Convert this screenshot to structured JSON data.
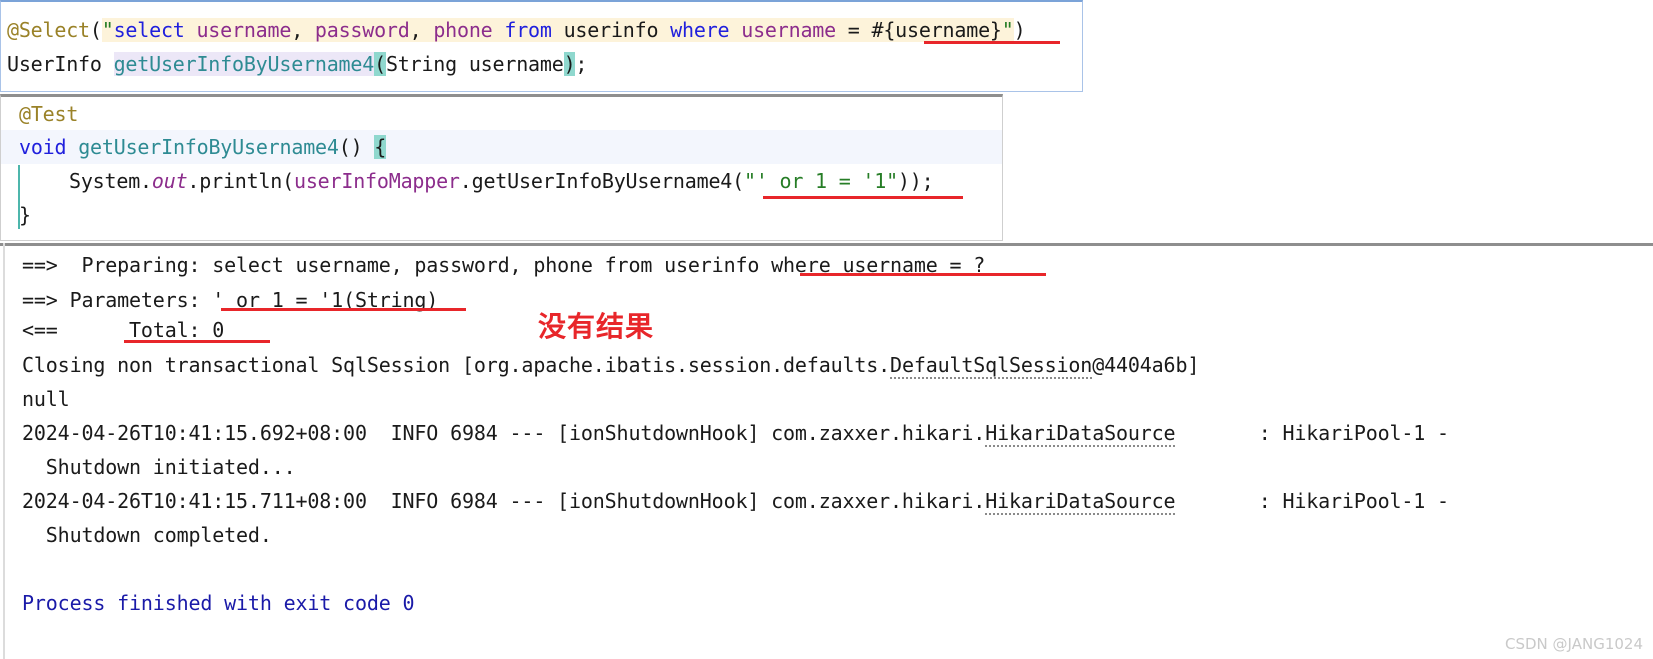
{
  "mapper_panel": {
    "name": "mapper-interface-snippet",
    "line1": {
      "annotation": "@Select",
      "paren_open": "(",
      "quote_open": "\"",
      "sql_select": "select",
      "sql_sp1": " ",
      "sql_username": "username",
      "sql_comma1": ", ",
      "sql_password": "password",
      "sql_comma2": ", ",
      "sql_phone": "phone",
      "sql_sp2": " ",
      "sql_from": "from",
      "sql_sp3": " ",
      "sql_table": "userinfo",
      "sql_sp4": " ",
      "sql_where": "where",
      "sql_sp5": " ",
      "sql_col": "username",
      "sql_eq": " = ",
      "sql_param": "#{username}",
      "quote_close": "\"",
      "paren_close": ")",
      "full_text": "@Select(\"select username, password, phone from userinfo where username = #{username}\")"
    },
    "line2": {
      "return_type": "UserInfo",
      "space": " ",
      "method_name": "getUserInfoByUsername4",
      "paren_open": "(",
      "param_type": "String",
      "param_space": " ",
      "param_name": "username",
      "paren_close": ")",
      "semicolon": ";",
      "full_text": "UserInfo getUserInfoByUsername4(String username);"
    }
  },
  "test_panel": {
    "name": "test-method-snippet",
    "line1": {
      "annotation": "@Test"
    },
    "line2": {
      "keyword_void": "void",
      "space": " ",
      "method_name": "getUserInfoByUsername4",
      "parens": "()",
      "space2": " ",
      "brace": "{"
    },
    "line3": {
      "system": "System",
      "dot1": ".",
      "out": "out",
      "dot2": ".",
      "println": "println",
      "paren_open": "(",
      "mapper_field": "userInfoMapper",
      "dot3": ".",
      "call_method": "getUserInfoByUsername4",
      "call_paren": "(",
      "string_literal": "\"' or 1 = '1\"",
      "tail": "));"
    },
    "line4": {
      "brace": "}"
    }
  },
  "console": {
    "name": "run-console-output",
    "lines": [
      {
        "text": "==>  Preparing: select username, password, phone from userinfo where username = ?",
        "color": "black"
      },
      {
        "text": "==> Parameters: ' or 1 = '1(String)",
        "color": "black"
      },
      {
        "text": "<==      Total: 0",
        "color": "black"
      },
      {
        "text": "Closing non transactional SqlSession [org.apache.ibatis.session.defaults.DefaultSqlSession@4404a6b]",
        "color": "black"
      },
      {
        "text": "null",
        "color": "black"
      },
      {
        "text": "2024-04-26T10:41:15.692+08:00  INFO 6984 --- [ionShutdownHook] com.zaxxer.hikari.HikariDataSource       : HikariPool-1 -",
        "color": "black"
      },
      {
        "text": "  Shutdown initiated...",
        "color": "black"
      },
      {
        "text": "2024-04-26T10:41:15.711+08:00  INFO 6984 --- [ionShutdownHook] com.zaxxer.hikari.HikariDataSource       : HikariPool-1 -",
        "color": "black"
      },
      {
        "text": "  Shutdown completed.",
        "color": "black"
      },
      {
        "text": "Process finished with exit code 0",
        "color": "blue"
      }
    ],
    "line_parts": {
      "prep_prefix": "==>  Preparing: select username, password, phone from userinfo ",
      "prep_underlined": "where username = ?",
      "params_prefix": "==> Parameters: ",
      "params_underlined": "' or 1 = '1(String)",
      "total_prefix": "<==      ",
      "total_underlined": "Total: 0",
      "closing_a": "Closing non transactional SqlSession [org.apache.ibatis.session.defaults.",
      "closing_link": "DefaultSqlSession",
      "closing_b": "@4404a6b]",
      "null_text": "null",
      "log1_a": "2024-04-26T10:41:15.692+08:00  INFO 6984 --- [ionShutdownHook] com.zaxxer.hikari.",
      "log1_link": "HikariDataSource",
      "log1_b": "       : HikariPool-1 -",
      "log1_wrap": "  Shutdown initiated...",
      "log2_a": "2024-04-26T10:41:15.711+08:00  INFO 6984 --- [ionShutdownHook] com.zaxxer.hikari.",
      "log2_link": "HikariDataSource",
      "log2_b": "       : HikariPool-1 -",
      "log2_wrap": "  Shutdown completed.",
      "finished": "Process finished with exit code 0"
    }
  },
  "annotation_note": {
    "text": "没有结果",
    "color": "#e8262a"
  },
  "watermark": {
    "text": "CSDN @JANG1024"
  },
  "colors": {
    "annotation": "#9a8228",
    "sql_keyword": "#2020dd",
    "sql_identifier": "#8c2d8c",
    "string_green": "#267d26",
    "method_teal": "#2e8b93",
    "red_mark": "#e8262a",
    "console_blue": "#1a1aa8",
    "highlight_yellow": "#fdf3da",
    "highlight_lavender": "#ece7f7",
    "brace_match": "#8fd8ce"
  }
}
